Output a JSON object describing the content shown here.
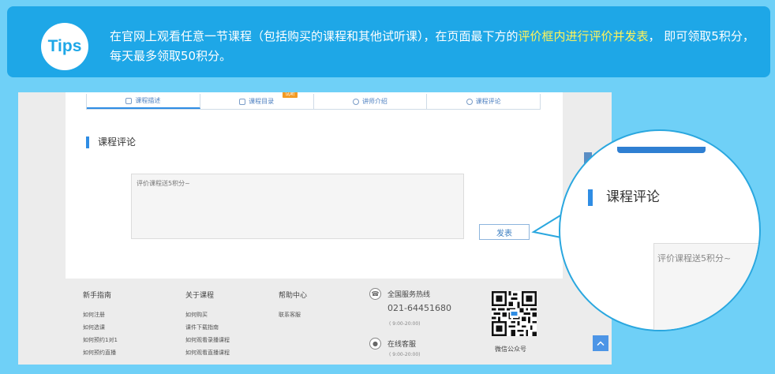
{
  "tips": {
    "badge": "Tips",
    "text_before": "在官网上观看任意一节课程（包括购买的课程和其他试听课），在页面最下方的",
    "text_highlight": "评价框内进行评价并发表",
    "text_after": "，  即可领取5积分，每天最多领取50积分。"
  },
  "tabs": [
    {
      "label": "课程描述",
      "icon": "document-icon"
    },
    {
      "label": "课程目录",
      "icon": "catalog-icon",
      "badge": "试听"
    },
    {
      "label": "讲师介绍",
      "icon": "user-icon"
    },
    {
      "label": "课程评论",
      "icon": "comment-icon"
    }
  ],
  "section_title": "课程评论",
  "comment": {
    "placeholder": "评价课程送5积分~",
    "submit": "发表"
  },
  "footer": {
    "columns": [
      {
        "title": "新手指南",
        "links": [
          "如何注册",
          "如何选课",
          "如何预约1对1",
          "如何预约直播"
        ]
      },
      {
        "title": "关于课程",
        "links": [
          "如何购买",
          "课件下载指南",
          "如何观看录播课程",
          "如何观看直播课程"
        ]
      },
      {
        "title": "帮助中心",
        "links": [
          "联系客服"
        ]
      }
    ],
    "hotline_label": "全国服务热线",
    "hotline_number": "021-64451680",
    "hotline_hours": "( 9:00-20:00)",
    "online_label": "在线客服",
    "online_hours": "( 9:00-20:00)",
    "wechat_label": "微信公众号",
    "top_icon": "chevron-up-icon"
  },
  "zoom": {
    "title": "课程评论",
    "placeholder": "评价课程送5积分~"
  },
  "colors": {
    "background": "#6fd0f7",
    "banner": "#1ea7e7",
    "accent": "#2f8de4",
    "highlight": "#fff35a"
  }
}
